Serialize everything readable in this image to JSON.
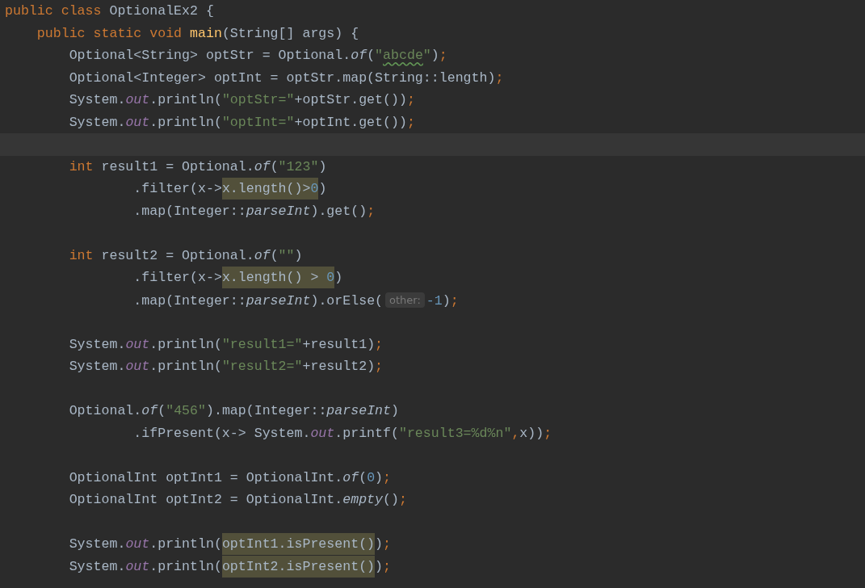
{
  "editor": {
    "lines": [
      {
        "kind": "code",
        "tokens": [
          {
            "kind": "keyword",
            "text": "public class "
          },
          {
            "kind": "plain",
            "text": "OptionalEx2 {"
          }
        ]
      },
      {
        "kind": "code",
        "tokens": [
          {
            "kind": "keyword",
            "text": "    public static void "
          },
          {
            "kind": "declaration",
            "text": "main"
          },
          {
            "kind": "plain",
            "text": "(String[] args) {"
          }
        ]
      },
      {
        "kind": "code",
        "tokens": [
          {
            "kind": "plain",
            "text": "        Optional<String> optStr = Optional."
          },
          {
            "kind": "static-method",
            "text": "of"
          },
          {
            "kind": "plain",
            "text": "("
          },
          {
            "kind": "string",
            "text": "\""
          },
          {
            "kind": "string",
            "text": "abcde",
            "typo": true
          },
          {
            "kind": "string",
            "text": "\""
          },
          {
            "kind": "plain",
            "text": ")"
          },
          {
            "kind": "keyword",
            "text": ";"
          }
        ]
      },
      {
        "kind": "code",
        "tokens": [
          {
            "kind": "plain",
            "text": "        Optional<Integer> optInt = optStr.map(String::length)"
          },
          {
            "kind": "keyword",
            "text": ";"
          }
        ]
      },
      {
        "kind": "code",
        "tokens": [
          {
            "kind": "plain",
            "text": "        System."
          },
          {
            "kind": "static-field",
            "text": "out"
          },
          {
            "kind": "plain",
            "text": ".println("
          },
          {
            "kind": "string",
            "text": "\"optStr=\""
          },
          {
            "kind": "plain",
            "text": "+optStr.get())"
          },
          {
            "kind": "keyword",
            "text": ";"
          }
        ]
      },
      {
        "kind": "code",
        "tokens": [
          {
            "kind": "plain",
            "text": "        System."
          },
          {
            "kind": "static-field",
            "text": "out"
          },
          {
            "kind": "plain",
            "text": ".println("
          },
          {
            "kind": "string",
            "text": "\"optInt=\""
          },
          {
            "kind": "plain",
            "text": "+optInt.get())"
          },
          {
            "kind": "keyword",
            "text": ";"
          }
        ]
      },
      {
        "kind": "caret"
      },
      {
        "kind": "code",
        "tokens": [
          {
            "kind": "keyword",
            "text": "        int "
          },
          {
            "kind": "plain",
            "text": "result1 = Optional."
          },
          {
            "kind": "static-method",
            "text": "of"
          },
          {
            "kind": "plain",
            "text": "("
          },
          {
            "kind": "string",
            "text": "\"123\""
          },
          {
            "kind": "plain",
            "text": ")"
          }
        ]
      },
      {
        "kind": "code",
        "tokens": [
          {
            "kind": "plain",
            "text": "                .filter(x->"
          },
          {
            "kind": "plain",
            "text": "x.length()>",
            "highlight": true
          },
          {
            "kind": "number",
            "text": "0",
            "highlight": true
          },
          {
            "kind": "plain",
            "text": ")"
          }
        ]
      },
      {
        "kind": "code",
        "tokens": [
          {
            "kind": "plain",
            "text": "                .map(Integer::"
          },
          {
            "kind": "static-method",
            "text": "parseInt"
          },
          {
            "kind": "plain",
            "text": ").get()"
          },
          {
            "kind": "keyword",
            "text": ";"
          }
        ]
      },
      {
        "kind": "blank"
      },
      {
        "kind": "code",
        "tokens": [
          {
            "kind": "keyword",
            "text": "        int "
          },
          {
            "kind": "plain",
            "text": "result2 = Optional."
          },
          {
            "kind": "static-method",
            "text": "of"
          },
          {
            "kind": "plain",
            "text": "("
          },
          {
            "kind": "string",
            "text": "\"\""
          },
          {
            "kind": "plain",
            "text": ")"
          }
        ]
      },
      {
        "kind": "code",
        "tokens": [
          {
            "kind": "plain",
            "text": "                .filter(x->"
          },
          {
            "kind": "plain",
            "text": "x.length() > ",
            "highlight": true
          },
          {
            "kind": "number",
            "text": "0",
            "highlight": true
          },
          {
            "kind": "plain",
            "text": ")"
          }
        ]
      },
      {
        "kind": "code",
        "tokens": [
          {
            "kind": "plain",
            "text": "                .map(Integer::"
          },
          {
            "kind": "static-method",
            "text": "parseInt"
          },
          {
            "kind": "plain",
            "text": ").orElse("
          },
          {
            "kind": "hint",
            "text": "other:"
          },
          {
            "kind": "number",
            "text": "-1"
          },
          {
            "kind": "plain",
            "text": ")"
          },
          {
            "kind": "keyword",
            "text": ";"
          }
        ]
      },
      {
        "kind": "blank"
      },
      {
        "kind": "code",
        "tokens": [
          {
            "kind": "plain",
            "text": "        System."
          },
          {
            "kind": "static-field",
            "text": "out"
          },
          {
            "kind": "plain",
            "text": ".println("
          },
          {
            "kind": "string",
            "text": "\"result1=\""
          },
          {
            "kind": "plain",
            "text": "+result1)"
          },
          {
            "kind": "keyword",
            "text": ";"
          }
        ]
      },
      {
        "kind": "code",
        "tokens": [
          {
            "kind": "plain",
            "text": "        System."
          },
          {
            "kind": "static-field",
            "text": "out"
          },
          {
            "kind": "plain",
            "text": ".println("
          },
          {
            "kind": "string",
            "text": "\"result2=\""
          },
          {
            "kind": "plain",
            "text": "+result2)"
          },
          {
            "kind": "keyword",
            "text": ";"
          }
        ]
      },
      {
        "kind": "blank"
      },
      {
        "kind": "code",
        "tokens": [
          {
            "kind": "plain",
            "text": "        Optional."
          },
          {
            "kind": "static-method",
            "text": "of"
          },
          {
            "kind": "plain",
            "text": "("
          },
          {
            "kind": "string",
            "text": "\"456\""
          },
          {
            "kind": "plain",
            "text": ").map(Integer::"
          },
          {
            "kind": "static-method",
            "text": "parseInt"
          },
          {
            "kind": "plain",
            "text": ")"
          }
        ]
      },
      {
        "kind": "code",
        "tokens": [
          {
            "kind": "plain",
            "text": "                .ifPresent(x-> System."
          },
          {
            "kind": "static-field",
            "text": "out"
          },
          {
            "kind": "plain",
            "text": ".printf("
          },
          {
            "kind": "string",
            "text": "\"result3=%d%n\""
          },
          {
            "kind": "keyword",
            "text": ","
          },
          {
            "kind": "plain",
            "text": "x))"
          },
          {
            "kind": "keyword",
            "text": ";"
          }
        ]
      },
      {
        "kind": "blank"
      },
      {
        "kind": "code",
        "tokens": [
          {
            "kind": "plain",
            "text": "        OptionalInt optInt1 = OptionalInt."
          },
          {
            "kind": "static-method",
            "text": "of"
          },
          {
            "kind": "plain",
            "text": "("
          },
          {
            "kind": "number",
            "text": "0"
          },
          {
            "kind": "plain",
            "text": ")"
          },
          {
            "kind": "keyword",
            "text": ";"
          }
        ]
      },
      {
        "kind": "code",
        "tokens": [
          {
            "kind": "plain",
            "text": "        OptionalInt optInt2 = OptionalInt."
          },
          {
            "kind": "static-method",
            "text": "empty"
          },
          {
            "kind": "plain",
            "text": "()"
          },
          {
            "kind": "keyword",
            "text": ";"
          }
        ]
      },
      {
        "kind": "blank"
      },
      {
        "kind": "code",
        "tokens": [
          {
            "kind": "plain",
            "text": "        System."
          },
          {
            "kind": "static-field",
            "text": "out"
          },
          {
            "kind": "plain",
            "text": ".println("
          },
          {
            "kind": "plain",
            "text": "optInt1.isPresent()",
            "highlight": true
          },
          {
            "kind": "plain",
            "text": ")"
          },
          {
            "kind": "keyword",
            "text": ";"
          }
        ]
      },
      {
        "kind": "code",
        "tokens": [
          {
            "kind": "plain",
            "text": "        System."
          },
          {
            "kind": "static-field",
            "text": "out"
          },
          {
            "kind": "plain",
            "text": ".println("
          },
          {
            "kind": "plain",
            "text": "optInt2.isPresent()",
            "highlight": true
          },
          {
            "kind": "plain",
            "text": ")"
          },
          {
            "kind": "keyword",
            "text": ";"
          }
        ]
      }
    ]
  }
}
